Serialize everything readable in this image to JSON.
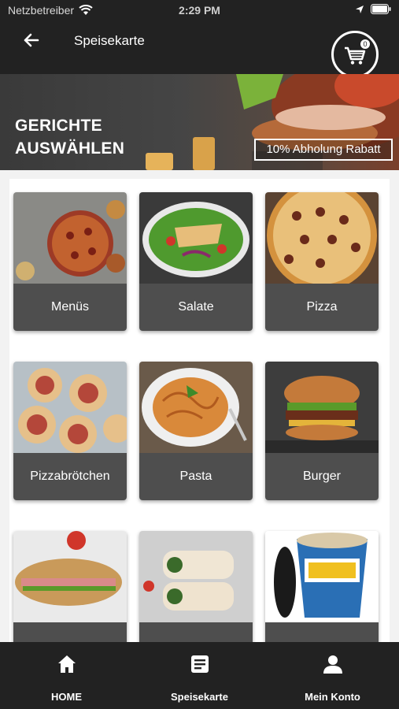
{
  "status_bar": {
    "carrier": "Netzbetreiber",
    "time": "2:29 PM"
  },
  "header": {
    "title": "Speisekarte",
    "cart_count": "0"
  },
  "hero": {
    "title_line1": "GERICHTE",
    "title_line2": "AUSWÄHLEN",
    "badge": "10% Abholung Rabatt"
  },
  "categories": [
    {
      "label": "Menüs"
    },
    {
      "label": "Salate"
    },
    {
      "label": "Pizza"
    },
    {
      "label": "Pizzabrötchen"
    },
    {
      "label": "Pasta"
    },
    {
      "label": "Burger"
    },
    {
      "label": ""
    },
    {
      "label": ""
    },
    {
      "label": ""
    }
  ],
  "bottom_nav": [
    {
      "label": "HOME",
      "icon": "home-icon"
    },
    {
      "label": "Speisekarte",
      "icon": "menu-document-icon"
    },
    {
      "label": "Mein Konto",
      "icon": "user-icon"
    }
  ],
  "colors": {
    "dark_bg": "#222222",
    "card_label_bg": "#4e4e4e",
    "accent_white": "#ffffff"
  }
}
